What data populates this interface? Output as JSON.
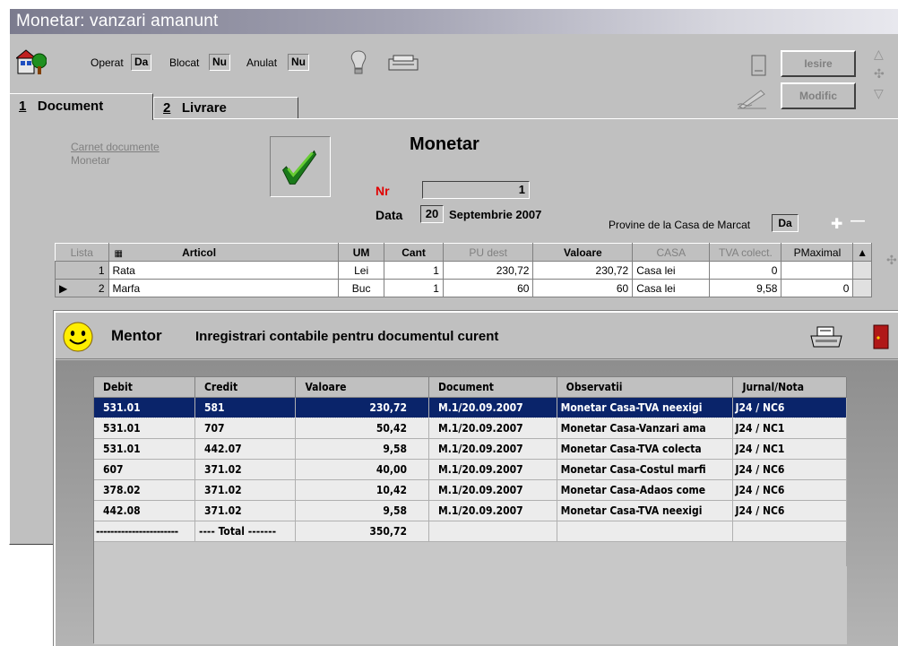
{
  "app": {
    "title": "Monetar: vanzari amanunt"
  },
  "toolbar": {
    "operat_label": "Operat",
    "operat_value": "Da",
    "blocat_label": "Blocat",
    "blocat_value": "Nu",
    "anulat_label": "Anulat",
    "anulat_value": "Nu",
    "iesire_label": "Iesire",
    "modific_label": "Modific"
  },
  "tabs": [
    {
      "number": "1",
      "label": "Document"
    },
    {
      "number": "2",
      "label": "Livrare"
    }
  ],
  "document": {
    "carnet_line1": "Carnet documente",
    "carnet_line2": "Monetar",
    "title": "Monetar",
    "nr_label": "Nr",
    "nr_value": "1",
    "data_label": "Data",
    "data_day": "20",
    "data_month_year": "Septembrie 2007",
    "provine_label": "Provine de la Casa de Marcat",
    "provine_value": "Da"
  },
  "items_grid": {
    "columns": [
      "Lista",
      "Articol",
      "UM",
      "Cant",
      "PU dest",
      "Valoare",
      "CASA",
      "TVA colect.",
      "PMaximal"
    ],
    "rows": [
      {
        "nr": "1",
        "articol": "Rata",
        "um": "Lei",
        "cant": "1",
        "pu_dest": "230,72",
        "valoare": "230,72",
        "casa": "Casa lei",
        "tva": "0",
        "pmaximal": ""
      },
      {
        "nr": "2",
        "articol": "Marfa",
        "um": "Buc",
        "cant": "1",
        "pu_dest": "60",
        "valoare": "60",
        "casa": "Casa lei",
        "tva": "9,58",
        "pmaximal": "0"
      }
    ]
  },
  "mentor": {
    "brand": "Mentor",
    "title": "Inregistrari contabile pentru documentul curent",
    "columns": [
      "Debit",
      "Credit",
      "Valoare",
      "Document",
      "Observatii",
      "Jurnal/Nota"
    ],
    "rows": [
      {
        "debit": "531.01",
        "credit": "581",
        "valoare": "230,72",
        "document": "M.1/20.09.2007",
        "observatii": "Monetar Casa-TVA neexigi",
        "jurnal": "J24 / NC6"
      },
      {
        "debit": "531.01",
        "credit": "707",
        "valoare": "50,42",
        "document": "M.1/20.09.2007",
        "observatii": "Monetar Casa-Vanzari ama",
        "jurnal": "J24 / NC1"
      },
      {
        "debit": "531.01",
        "credit": "442.07",
        "valoare": "9,58",
        "document": "M.1/20.09.2007",
        "observatii": "Monetar Casa-TVA colecta",
        "jurnal": "J24 / NC1"
      },
      {
        "debit": "607",
        "credit": "371.02",
        "valoare": "40,00",
        "document": "M.1/20.09.2007",
        "observatii": "Monetar Casa-Costul marfi",
        "jurnal": "J24 / NC6"
      },
      {
        "debit": "378.02",
        "credit": "371.02",
        "valoare": "10,42",
        "document": "M.1/20.09.2007",
        "observatii": "Monetar Casa-Adaos come",
        "jurnal": "J24 / NC6"
      },
      {
        "debit": "442.08",
        "credit": "371.02",
        "valoare": "9,58",
        "document": "M.1/20.09.2007",
        "observatii": "Monetar Casa-TVA neexigi",
        "jurnal": "J24 / NC6"
      }
    ],
    "total": {
      "debit": "-----------------------",
      "credit": "---- Total -------",
      "valoare": "350,72"
    }
  },
  "colors": {
    "selection": "#0a246a",
    "window_face": "#c0c0c0"
  }
}
